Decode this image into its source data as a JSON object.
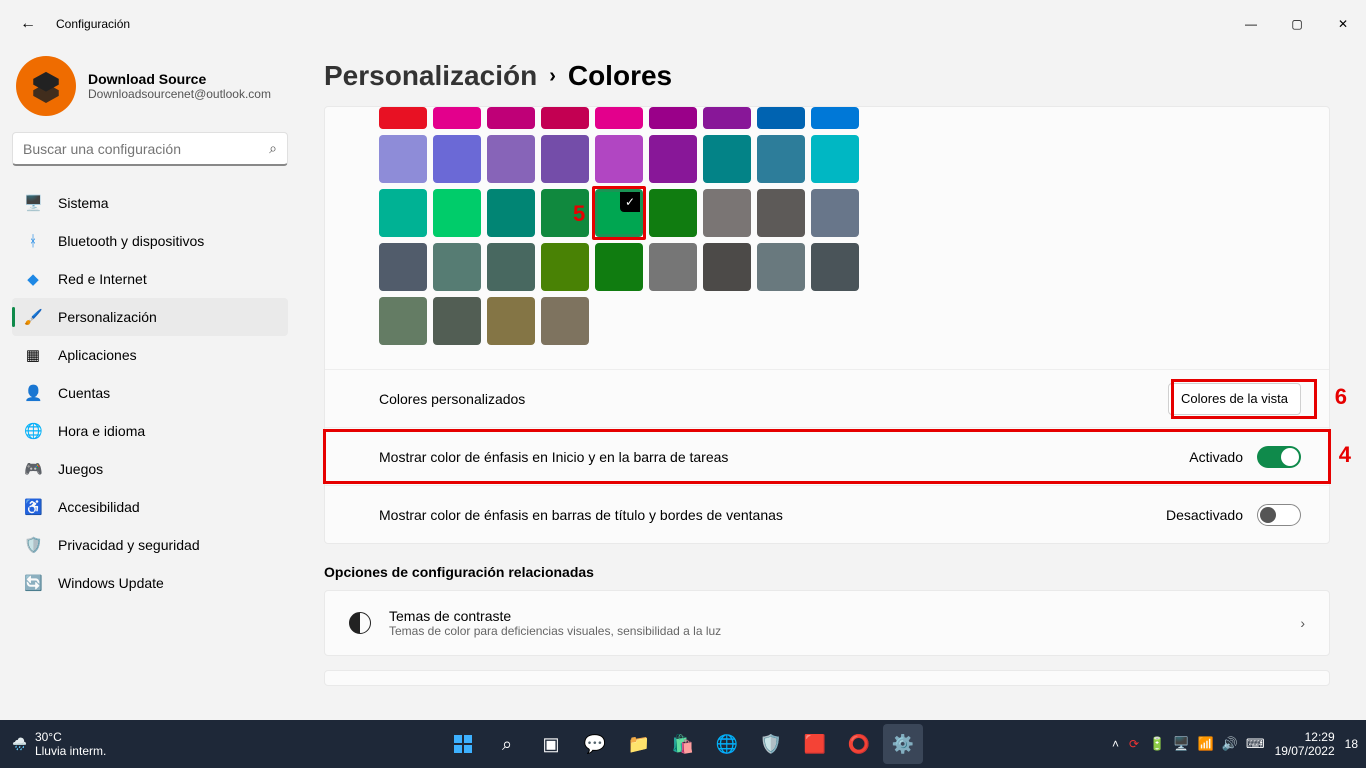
{
  "window": {
    "title": "Configuración"
  },
  "profile": {
    "name": "Download Source",
    "email": "Downloadsourcenet@outlook.com"
  },
  "search": {
    "placeholder": "Buscar una configuración"
  },
  "nav": {
    "items": [
      {
        "icon": "🖥️",
        "label": "Sistema"
      },
      {
        "icon": "ᚼ",
        "label": "Bluetooth y dispositivos",
        "iconColor": "#1e88e5"
      },
      {
        "icon": "◆",
        "label": "Red e Internet",
        "iconColor": "#1e88e5"
      },
      {
        "icon": "🖌️",
        "label": "Personalización",
        "active": true
      },
      {
        "icon": "▦",
        "label": "Aplicaciones"
      },
      {
        "icon": "👤",
        "label": "Cuentas"
      },
      {
        "icon": "🌐",
        "label": "Hora e idioma"
      },
      {
        "icon": "🎮",
        "label": "Juegos"
      },
      {
        "icon": "♿",
        "label": "Accesibilidad"
      },
      {
        "icon": "🛡️",
        "label": "Privacidad y seguridad"
      },
      {
        "icon": "🔄",
        "label": "Windows Update"
      }
    ]
  },
  "breadcrumb": {
    "parent": "Personalización",
    "sep": "›",
    "current": "Colores"
  },
  "palette": {
    "rows": [
      [
        "#e81123",
        "#e3008c",
        "#bf0077",
        "#c30052",
        "#e3008c",
        "#9a0089",
        "#881798",
        "#0063b1",
        "#0078d7"
      ],
      [
        "#8e8cd8",
        "#6b69d6",
        "#8764b8",
        "#744da9",
        "#b146c2",
        "#881798",
        "#038387",
        "#2d7d9a",
        "#00b7c3"
      ],
      [
        "#00b294",
        "#00cc6a",
        "#018574",
        "#10893e",
        "#00a651",
        "#107c10",
        "#7a7574",
        "#5d5a58",
        "#68768a",
        "#515c6b"
      ],
      [
        "#567c73",
        "#486860",
        "#498205",
        "#107c10",
        "#767676",
        "#4c4a48",
        "#69797e",
        "#4a5459",
        "#647c64"
      ],
      [
        "#525e54",
        "#847545",
        "#7e735f"
      ]
    ],
    "selected": {
      "row": 2,
      "col": 4
    },
    "annotation5": "5"
  },
  "rows": {
    "custom": {
      "label": "Colores personalizados",
      "button": "Colores de la vista",
      "annot": "6"
    },
    "accentStart": {
      "label": "Mostrar color de énfasis en Inicio y en la barra de tareas",
      "state": "Activado",
      "on": true,
      "annot": "4"
    },
    "accentTitle": {
      "label": "Mostrar color de énfasis en barras de título y bordes de ventanas",
      "state": "Desactivado",
      "on": false
    }
  },
  "related": {
    "heading": "Opciones de configuración relacionadas",
    "contrast": {
      "title": "Temas de contraste",
      "subtitle": "Temas de color para deficiencias visuales, sensibilidad a la luz"
    }
  },
  "taskbar": {
    "weather": {
      "temp": "30°C",
      "desc": "Lluvia interm."
    },
    "tray": {
      "num18": "18",
      "time": "12:29",
      "date": "19/07/2022",
      "badge": "18"
    }
  }
}
